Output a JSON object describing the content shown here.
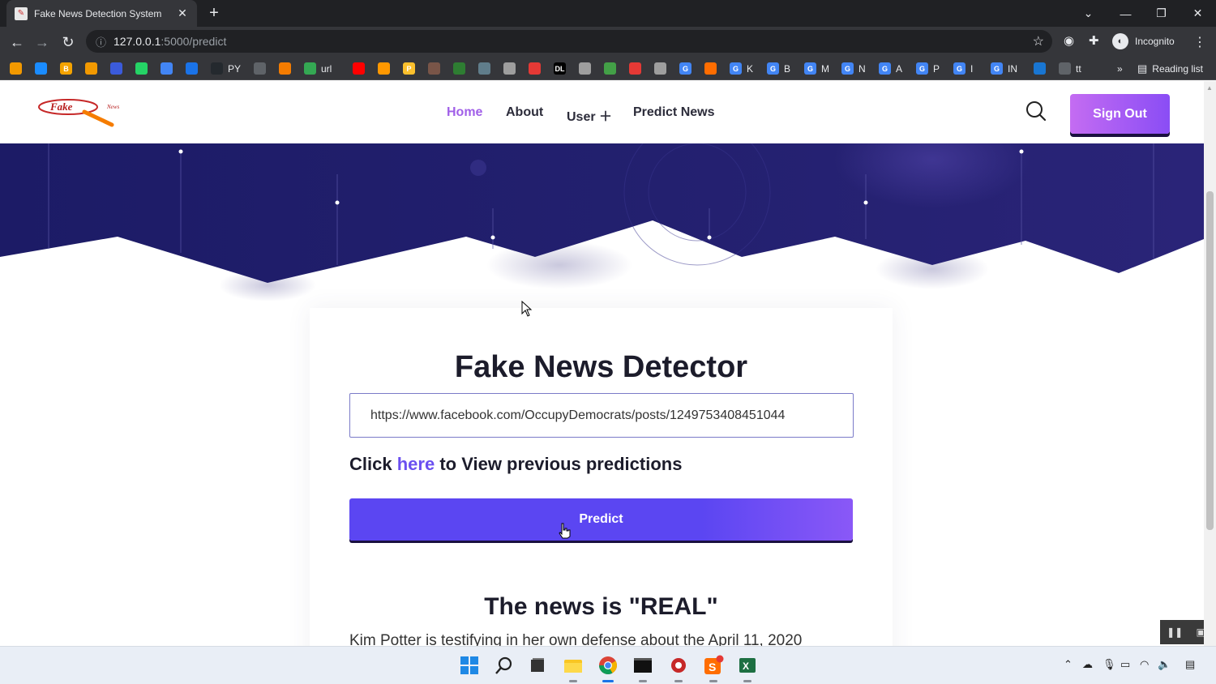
{
  "browser": {
    "tab_title": "Fake News Detection System",
    "tab_close": "✕",
    "new_tab": "+",
    "url_host": "127.0.0.1",
    "url_rest": ":5000/predict",
    "profile_label": "Incognito",
    "reading_list_label": "Reading list",
    "more_bookmarks": "»",
    "bookmarks": [
      {
        "icon": "",
        "label": "",
        "color": "#f29900"
      },
      {
        "icon": "",
        "label": "",
        "color": "#1a8cff"
      },
      {
        "icon": "B",
        "label": "",
        "color": "#f4a300"
      },
      {
        "icon": "",
        "label": "",
        "color": "#f29900"
      },
      {
        "icon": "",
        "label": "",
        "color": "#3b5bdb"
      },
      {
        "icon": "",
        "label": "",
        "color": "#25d366"
      },
      {
        "icon": "",
        "label": "",
        "color": "#4285f4"
      },
      {
        "icon": "",
        "label": "",
        "color": "#1a73e8"
      },
      {
        "icon": "",
        "label": "PY",
        "color": "#24292e"
      },
      {
        "icon": "",
        "label": "",
        "color": "#5f6368"
      },
      {
        "icon": "",
        "label": "",
        "color": "#f57c00"
      },
      {
        "icon": "",
        "label": "url",
        "color": "#34a853"
      },
      {
        "icon": "",
        "label": "",
        "color": "#ff0000"
      },
      {
        "icon": "",
        "label": "",
        "color": "#ff9800"
      },
      {
        "icon": "P",
        "label": "",
        "color": "#fbc02d"
      },
      {
        "icon": "",
        "label": "",
        "color": "#795548"
      },
      {
        "icon": "",
        "label": "",
        "color": "#2e7d32"
      },
      {
        "icon": "",
        "label": "",
        "color": "#607d8b"
      },
      {
        "icon": "",
        "label": "",
        "color": "#9e9e9e"
      },
      {
        "icon": "",
        "label": "",
        "color": "#e53935"
      },
      {
        "icon": "DL",
        "label": "",
        "color": "#000000"
      },
      {
        "icon": "",
        "label": "",
        "color": "#9e9e9e"
      },
      {
        "icon": "",
        "label": "",
        "color": "#43a047"
      },
      {
        "icon": "",
        "label": "",
        "color": "#e53935"
      },
      {
        "icon": "",
        "label": "",
        "color": "#9e9e9e"
      },
      {
        "icon": "G",
        "label": "",
        "color": "#4285f4"
      },
      {
        "icon": "",
        "label": "",
        "color": "#ff6d00"
      },
      {
        "icon": "G",
        "label": "K",
        "color": "#4285f4"
      },
      {
        "icon": "G",
        "label": "B",
        "color": "#4285f4"
      },
      {
        "icon": "G",
        "label": "M",
        "color": "#4285f4"
      },
      {
        "icon": "G",
        "label": "N",
        "color": "#4285f4"
      },
      {
        "icon": "G",
        "label": "A",
        "color": "#4285f4"
      },
      {
        "icon": "G",
        "label": "P",
        "color": "#4285f4"
      },
      {
        "icon": "G",
        "label": "I",
        "color": "#4285f4"
      },
      {
        "icon": "G",
        "label": "IN",
        "color": "#4285f4"
      },
      {
        "icon": "",
        "label": "",
        "color": "#1976d2"
      },
      {
        "icon": "",
        "label": "tt",
        "color": "#5f6368"
      }
    ]
  },
  "site": {
    "logo_text": "Fake",
    "logo_sub": "News",
    "nav": [
      {
        "label": "Home",
        "active": true
      },
      {
        "label": "About",
        "active": false
      },
      {
        "label": "User ＋",
        "active": false
      },
      {
        "label": "Predict News",
        "active": false
      }
    ],
    "signout_label": "Sign Out"
  },
  "detector": {
    "title": "Fake News Detector",
    "url_value": "https://www.facebook.com/OccupyDemocrats/posts/1249753408451044",
    "prev_prefix": "Click",
    "prev_link": "here",
    "prev_suffix": "to View previous predictions",
    "predict_label": "Predict",
    "result_text": "The news is \"REAL\"",
    "snippet": "Kim Potter is testifying in her own defense about the April 11, 2020"
  },
  "colors": {
    "accent": "#5b46f2",
    "nav_active": "#a160e8",
    "hero_dark": "#1b1a5e"
  }
}
